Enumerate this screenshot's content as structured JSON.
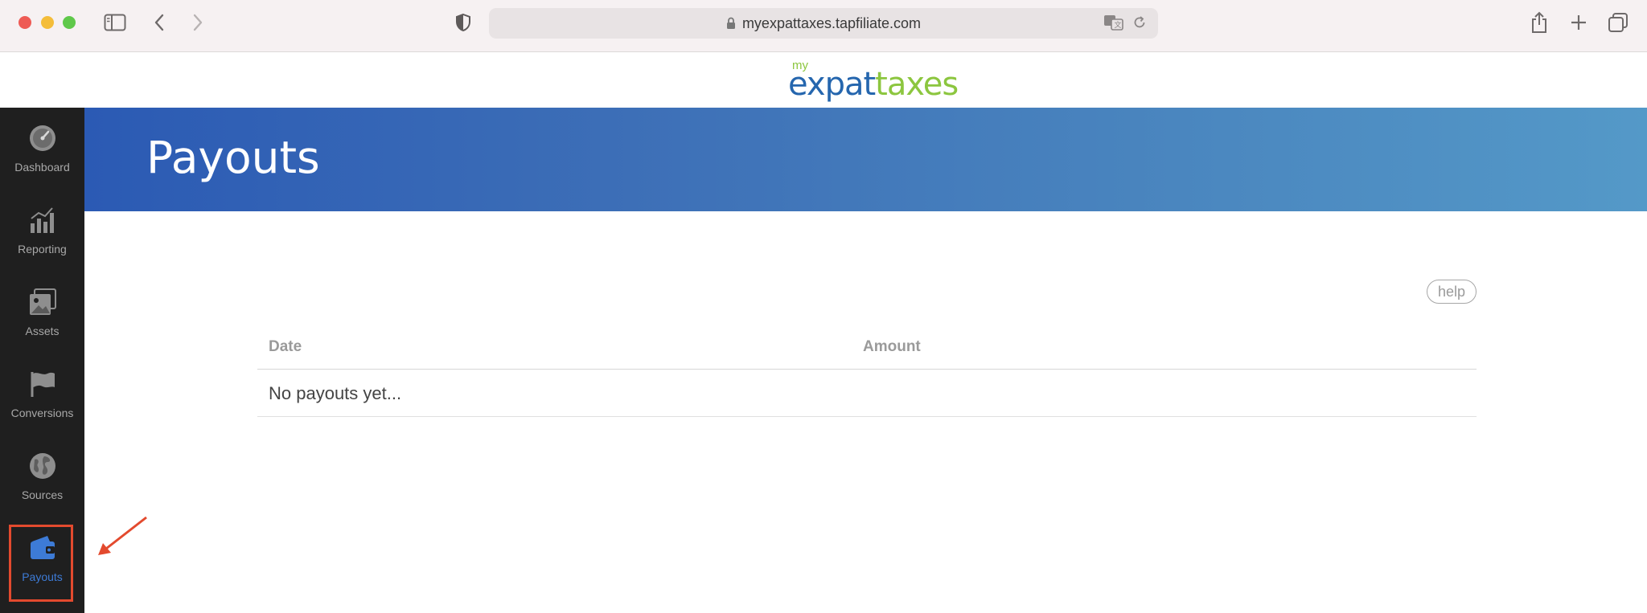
{
  "browser": {
    "url": "myexpattaxes.tapfiliate.com"
  },
  "logo": {
    "my": "my",
    "expat": "expat",
    "taxes": "taxes"
  },
  "sidebar": {
    "items": [
      {
        "label": "Dashboard",
        "icon": "gauge-icon"
      },
      {
        "label": "Reporting",
        "icon": "bar-chart-icon"
      },
      {
        "label": "Assets",
        "icon": "images-icon"
      },
      {
        "label": "Conversions",
        "icon": "flag-icon"
      },
      {
        "label": "Sources",
        "icon": "globe-icon"
      },
      {
        "label": "Payouts",
        "icon": "wallet-icon",
        "active": true
      }
    ]
  },
  "page": {
    "title": "Payouts",
    "help_label": "help"
  },
  "table": {
    "columns": [
      "Date",
      "Amount"
    ],
    "empty_message": "No payouts yet..."
  },
  "colors": {
    "active": "#3d7bd6",
    "highlight": "#e34a2e",
    "banner_start": "#2b5ab4",
    "banner_end": "#5499c8"
  }
}
